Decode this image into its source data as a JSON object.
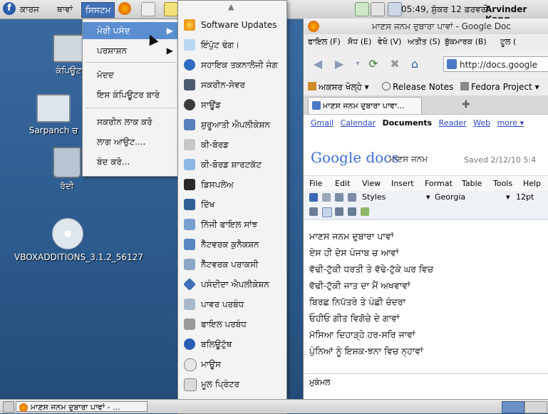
{
  "top_panel": {
    "menus": [
      "ਕਾਰਜ",
      "ਥਾਵਾਂ",
      "ਸਿਸਟਮ"
    ],
    "clock": "05:49, ਸ਼ੁੱਕਰ 12 ਫ਼ਰਵਰੀ",
    "user": "Arvinder Kang"
  },
  "desktop": {
    "icons": [
      {
        "label": "ਕੰਪਿਊਟਰ"
      },
      {
        "label": "Sarpanch ਚ"
      },
      {
        "label": "ਰੱਦੀ"
      },
      {
        "label": "VBOXADDITIONS_3.1.2_56127"
      }
    ]
  },
  "system_menu": {
    "items": [
      {
        "label": "ਮੇਰੀ ਪਸੰਦ"
      },
      {
        "label": "ਪਰਸ਼ਾਸ਼ਨ"
      },
      {
        "label": "ਮੱਦਦ"
      },
      {
        "label": "ਇਸ ਕੰਪਿਊਟਰ ਬਾਰੇ"
      },
      {
        "label": "ਸਕਰੀਨ ਲਾਕ ਕਰੋ"
      },
      {
        "label": "ਲਾਗ ਆਉਟ...."
      },
      {
        "label": "ਬੰਦ ਕਰੋ..."
      }
    ]
  },
  "preferences_menu": {
    "items": [
      {
        "label": "Software Updates",
        "icon": "software-updates-icon"
      },
      {
        "label": "ਇੰਪੁੱਟ ਢੰਗ।",
        "icon": "input-method-icon"
      },
      {
        "label": "ਸਹਾਇਕ ਤਕਨਾਲੋਜੀ ਜੰਗ",
        "icon": "accessibility-icon"
      },
      {
        "label": "ਸਕਰੀਨ-ਸੇਵਰ",
        "icon": "screensaver-icon"
      },
      {
        "label": "ਸਾਊਂਡ",
        "icon": "sound-icon"
      },
      {
        "label": "ਸ਼ੁਰੂਆਤੀ ਐਪਲੀਕੇਸ਼ਨ",
        "icon": "startup-apps-icon"
      },
      {
        "label": "ਕੀ-ਬੋਰਡ",
        "icon": "keyboard-icon"
      },
      {
        "label": "ਕੀ-ਬੋਰਡ ਸ਼ਾਰਟਕੱਟ",
        "icon": "keyboard-shortcuts-icon"
      },
      {
        "label": "ਡਿਸਪਲੇਅ",
        "icon": "display-icon"
      },
      {
        "label": "ਦਿੱਖ",
        "icon": "appearance-icon"
      },
      {
        "label": "ਨਿੱਜੀ ਫਾਇਲ ਸਾਂਝ",
        "icon": "file-sharing-icon"
      },
      {
        "label": "ਨੈੱਟਵਰਕ ਕੁਨੈਕਸ਼ਨ",
        "icon": "network-connections-icon"
      },
      {
        "label": "ਨੈੱਟਵਰਕ ਪਰਾਕਸੀ",
        "icon": "network-proxy-icon"
      },
      {
        "label": "ਪਸੰਦੀਦਾ ਐਪਲੀਕੇਸ਼ਨ",
        "icon": "preferred-apps-icon"
      },
      {
        "label": "ਪਾਵਰ ਪਰਬੰਧ",
        "icon": "power-management-icon"
      },
      {
        "label": "ਫਾਇਲ ਪਰਬੰਧ",
        "icon": "file-management-icon"
      },
      {
        "label": "ਬਲਿਊਟੁੱਥ",
        "icon": "bluetooth-icon"
      },
      {
        "label": "ਮਾਊਸ",
        "icon": "mouse-icon"
      },
      {
        "label": "ਮੂਲ ਪ੍ਰਿੰਟਰ",
        "icon": "printer-icon"
      }
    ]
  },
  "browser": {
    "title": "ਮਾਣਸ ਜਨਮ ਦੁਬਾਰਾ ਪਾਵਾਂ - Google Doc",
    "menubar": [
      "ਫਾਇਲ (F)",
      "ਸੋਧ (E)",
      "ਵੇਖੋ (V)",
      "ਅਤੀਤ (S)",
      "ਬੁੱਕਮਾਰਕ (B)",
      "ਟੂਲ ("
    ],
    "url": "http://docs.google",
    "bookmarks": [
      "ਅਕਸਰ ਖੋਲ੍ਹੇ",
      "Release Notes",
      "Fedora Project"
    ],
    "tab_title": "ਮਾਣਸ ਜਨਮ ਦੁਬਾਰਾ ਪਾਵਾ...",
    "google_links": [
      "Gmail",
      "Calendar",
      "Documents",
      "Reader",
      "Web",
      "more ▾"
    ],
    "logo_text": "Google docs",
    "doc_title": "ਮਾਣਸ ਜਨਮ",
    "saved_text": "Saved 2/12/10 5:4",
    "doc_menus": [
      "File",
      "Edit",
      "View",
      "Insert",
      "Format",
      "Table",
      "Tools",
      "Help"
    ],
    "styles_label": "Styles",
    "font_label": "Georgia",
    "size_label": "12pt",
    "poem_lines": [
      "ਮਾਣਸ ਜਨਮ ਦੁਬਾਰਾ ਪਾਵਾਂ",
      "ਏਸ ਹੀ ਦੇਸ ਪੰਜਾਬ ਚ ਆਵਾਂ",
      "ਵੱਢੀ-ਟੁੱਕੀ ਧਰਤੀ ਤੇ ਵੱਢੇ-ਟੁੱਕੇ ਘਰ ਵਿਚ",
      "ਵੱਢੀ-ਟੁੱਕੀ ਜਾਤ ਦਾ ਮੈਂ ਅਖਵਾਵਾਂ",
      "ਬਿਰਛ ਨਿਪੱਤਰੇ ਤੇ ਪੰਛੀ ਚੰਦਰਾ",
      "ਓਹੀਓ ਗੀਤ ਵਿਗੋਚੇ ਦੇ ਗਾਵਾਂ",
      "ਮੱਸਿਆ ਦਿਹਾੜ੍ਹੇ ਹਰ-ਸਰਿ ਜਾਵਾਂ",
      "ਪੁੰਨਿਆਂ ਨੂੰ ਇਸ਼ਕ-ਝਨਾ ਵਿਚ ਨ੍ਹਾਵਾਂ"
    ],
    "status": "ਮੁਕੰਮਲ"
  },
  "bottom_panel": {
    "task_label": "ਮਾਣਸ ਜਨਮ ਦੁਬਾਰਾ ਪਾਵਾਂ - ..."
  }
}
